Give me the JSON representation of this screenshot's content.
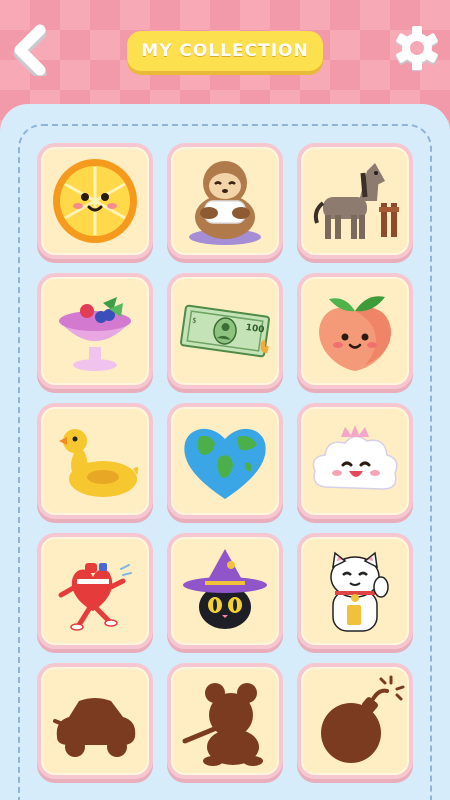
{
  "header": {
    "title": "MY COLLECTION",
    "back_icon": "chevron-left-icon",
    "settings_icon": "gear-icon"
  },
  "colors": {
    "background": "#f7a9b6",
    "panel": "#d6ecfb",
    "card": "#ffeec3",
    "card_border": "#f6c7d0",
    "title_pill": "#fde04d",
    "locked_silhouette": "#7a3b20"
  },
  "collection": [
    {
      "item": "orange",
      "unlocked": true
    },
    {
      "item": "sloth",
      "unlocked": true
    },
    {
      "item": "horse",
      "unlocked": true
    },
    {
      "item": "berry-smoothie",
      "unlocked": true
    },
    {
      "item": "dollar-bill",
      "unlocked": true
    },
    {
      "item": "peach",
      "unlocked": true
    },
    {
      "item": "rubber-duck-float",
      "unlocked": true
    },
    {
      "item": "earth-heart",
      "unlocked": true
    },
    {
      "item": "cloud-princess",
      "unlocked": true
    },
    {
      "item": "running-heart",
      "unlocked": true
    },
    {
      "item": "witch-cat",
      "unlocked": true
    },
    {
      "item": "lucky-cat",
      "unlocked": true
    },
    {
      "item": "car-silhouette",
      "unlocked": false
    },
    {
      "item": "teddy-silhouette",
      "unlocked": false
    },
    {
      "item": "bomb-silhouette",
      "unlocked": false
    }
  ]
}
